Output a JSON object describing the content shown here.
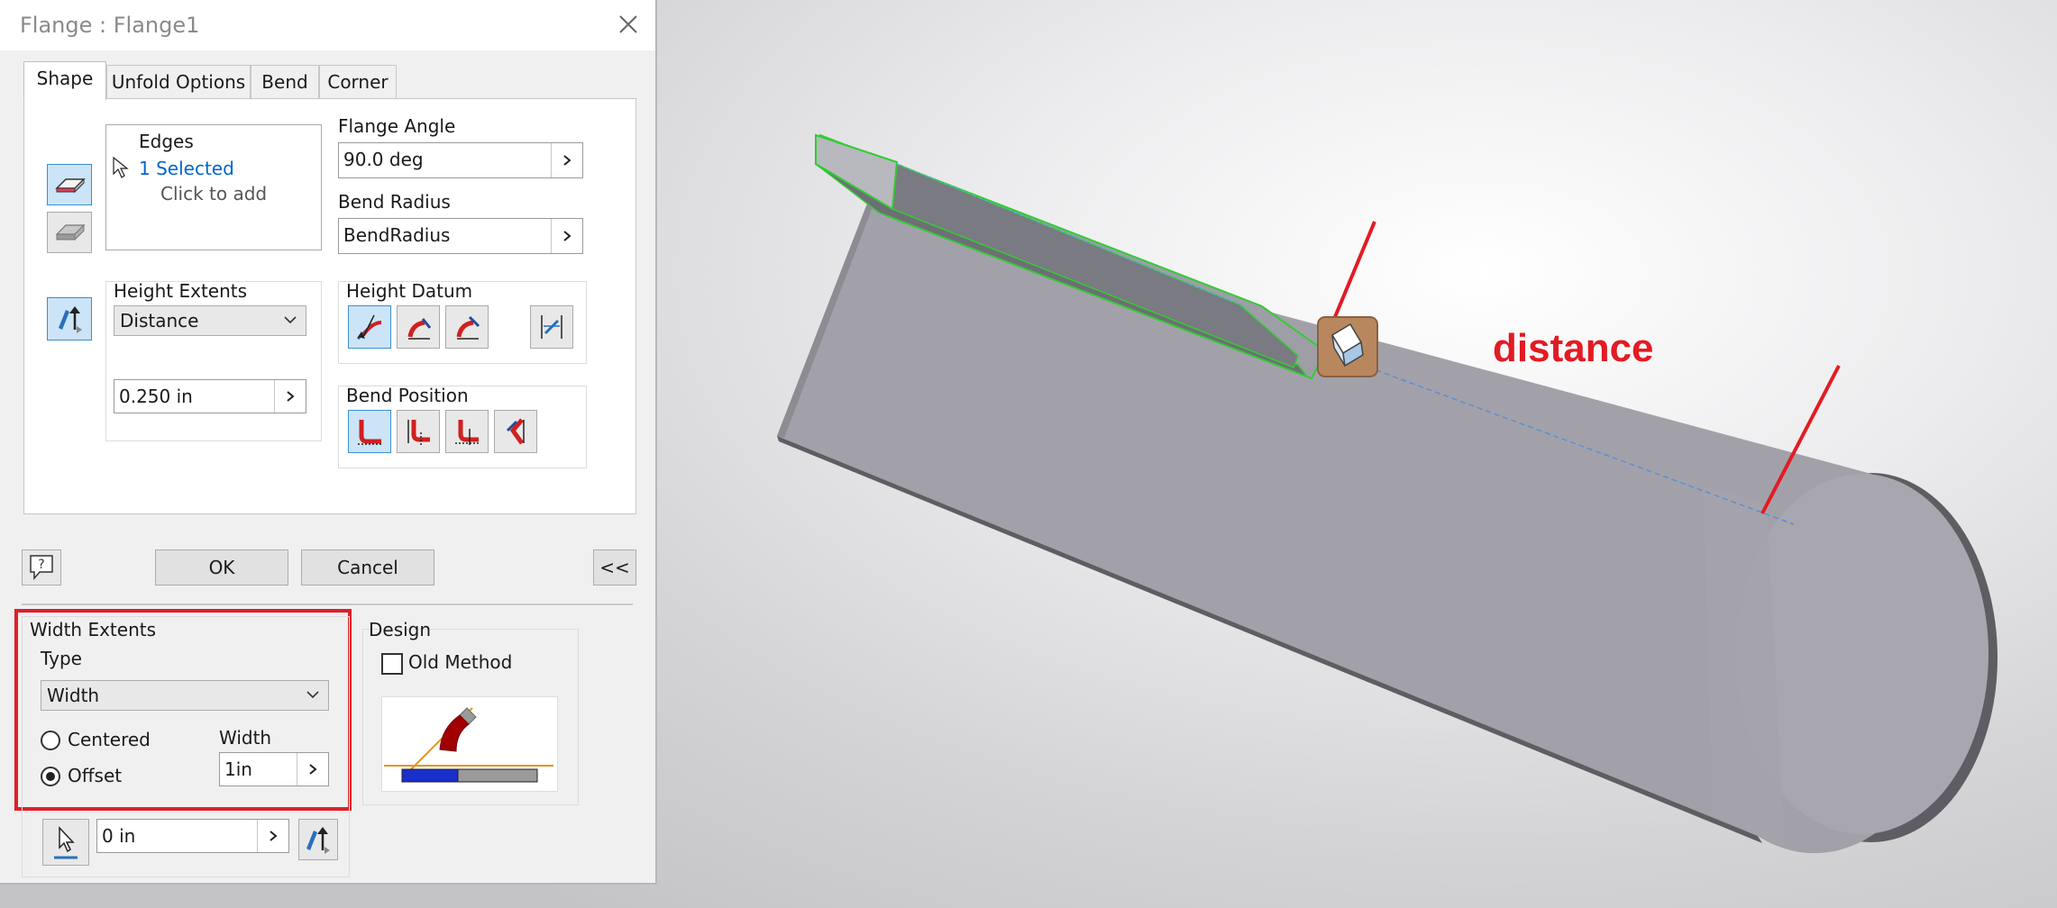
{
  "window": {
    "title": "Flange : Flange1"
  },
  "tabs": [
    {
      "label": "Shape",
      "active": true
    },
    {
      "label": "Unfold Options",
      "active": false
    },
    {
      "label": "Bend",
      "active": false
    },
    {
      "label": "Corner",
      "active": false
    }
  ],
  "edges": {
    "title": "Edges",
    "selected": "1 Selected",
    "hint": "Click to add",
    "selected_color": "#0066cc"
  },
  "flange_angle": {
    "label": "Flange Angle",
    "value": "90.0 deg"
  },
  "bend_radius": {
    "label": "Bend Radius",
    "value": "BendRadius"
  },
  "height_extents": {
    "label": "Height Extents",
    "type": "Distance",
    "value": "0.250 in"
  },
  "height_datum": {
    "label": "Height Datum"
  },
  "bend_position": {
    "label": "Bend Position"
  },
  "buttons": {
    "ok": "OK",
    "cancel": "Cancel",
    "collapse": "<<"
  },
  "width_extents": {
    "label": "Width Extents",
    "type_label": "Type",
    "type_value": "Width",
    "centered_label": "Centered",
    "offset_label": "Offset",
    "selected_option": "Offset",
    "width_label": "Width",
    "width_value": "1in",
    "offset_value": "0 in"
  },
  "design": {
    "label": "Design",
    "old_method_label": "Old Method",
    "old_method_checked": false
  },
  "viewport": {
    "annotation": "distance",
    "annotation_color": "#e31b23",
    "part_color": "#a2a1a9",
    "selection_color": "#33cc33"
  }
}
